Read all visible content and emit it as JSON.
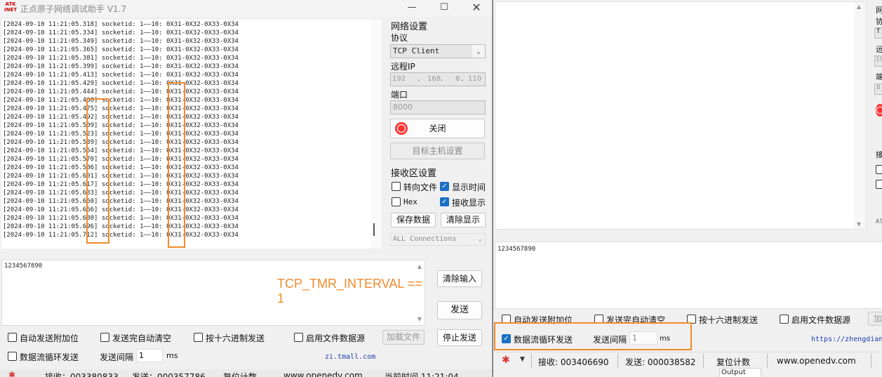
{
  "left": {
    "title": "正点原子网络调试助手 V1.7",
    "logo": "ATK INET",
    "log_lines": [
      "[2024-09-10 11:21:05.318] socketid: 1——10: 0X31-0X32-0X33-0X34",
      "[2024-09-10 11:21:05.334] socketid: 1——10: 0X31-0X32-0X33-0X34",
      "[2024-09-10 11:21:05.349] socketid: 1——10: 0X31-0X32-0X33-0X34",
      "[2024-09-10 11:21:05.365] socketid: 1——10: 0X31-0X32-0X33-0X34",
      "[2024-09-10 11:21:05.381] socketid: 1——10: 0X31-0X32-0X33-0X34",
      "[2024-09-10 11:21:05.399] socketid: 1——10: 0X31-0X32-0X33-0X34",
      "[2024-09-10 11:21:05.413] socketid: 1——10: 0X31-0X32-0X33-0X34",
      "[2024-09-10 11:21:05.429] socketid: 1——10: 0X31-0X32-0X33-0X34",
      "[2024-09-10 11:21:05.444] socketid: 1——10: 0X31-0X32-0X33-0X34",
      "[2024-09-10 11:21:05.460] socketid: 1——10: 0X31-0X32-0X33-0X34",
      "[2024-09-10 11:21:05.475] socketid: 1——10: 0X31-0X32-0X33-0X34",
      "[2024-09-10 11:21:05.492] socketid: 1——10: 0X31-0X32-0X33-0X34",
      "[2024-09-10 11:21:05.509] socketid: 1——10: 0X31-0X32-0X33-0X34",
      "[2024-09-10 11:21:05.523] socketid: 1——10: 0X31-0X32-0X33-0X34",
      "[2024-09-10 11:21:05.539] socketid: 1——10: 0X31-0X32-0X33-0X34",
      "[2024-09-10 11:21:05.554] socketid: 1——10: 0X31-0X32-0X33-0X34",
      "[2024-09-10 11:21:05.570] socketid: 1——10: 0X31-0X32-0X33-0X34",
      "[2024-09-10 11:21:05.586] socketid: 1——10: 0X31-0X32-0X33-0X34",
      "[2024-09-10 11:21:05.601] socketid: 1——10: 0X31-0X32-0X33-0X34",
      "[2024-09-10 11:21:05.617] socketid: 1——10: 0X31-0X32-0X33-0X34",
      "[2024-09-10 11:21:05.633] socketid: 1——10: 0X31-0X32-0X33-0X34",
      "[2024-09-10 11:21:05.650] socketid: 1——10: 0X31-0X32-0X33-0X34",
      "[2024-09-10 11:21:05.666] socketid: 1——10: 0X31-0X32-0X33-0X34",
      "[2024-09-10 11:21:05.680] socketid: 1——10: 0X31-0X32-0X33-0X34",
      "[2024-09-10 11:21:05.696] socketid: 1——10: 0X31-0X32-0X33-0X34",
      "[2024-09-10 11:21:05.712] socketid: 1——10: 0X31-0X32-0X33-0X34"
    ],
    "net": {
      "section": "网络设置",
      "protocol_label": "协议",
      "protocol_value": "TCP Client",
      "ip_label": "远程IP",
      "ip_parts": [
        "192",
        "168",
        "8",
        "110"
      ],
      "port_label": "端口",
      "port_value": "8000",
      "close_label": "关闭",
      "target_label": "目标主机设置"
    },
    "recv": {
      "section": "接收区设置",
      "to_file": "转向文件",
      "show_time": "显示时间",
      "hex": "Hex",
      "show_recv": "接收显示",
      "save": "保存数据",
      "clear": "清除显示",
      "connections": "ALL Connections"
    },
    "send_text": "1234567890",
    "annotation": "TCP_TMR_INTERVAL == 1",
    "clear_input": "清除输入",
    "send": "发送",
    "stop_send": "停止发送",
    "opts": {
      "auto_add": "自动发送附加位",
      "auto_clear": "发送完自动清空",
      "hex_send": "按十六进制发送",
      "file_source": "启用文件数据源",
      "load_file": "加载文件",
      "loop": "数据流循环发送",
      "interval_label": "发送间隔",
      "interval_value": "1",
      "ms": "ms",
      "link": "zi.tmall.com"
    },
    "status": {
      "recv": "接收：003380833",
      "send": "发送：000357786",
      "reset": "复位计数",
      "site": "www.openedv.com",
      "time": "当前时间 11:21:04"
    }
  },
  "right": {
    "send_text": "1234567890",
    "opts": {
      "auto_add": "自动发送附加位",
      "auto_clear": "发送完自动清空",
      "hex_send": "按十六进制发送",
      "file_source": "启用文件数据源",
      "load_file": "加载",
      "loop": "数据流循环发送",
      "interval_label": "发送间隔",
      "interval_value": "1",
      "ms": "ms",
      "link": "https://zhengdian"
    },
    "status": {
      "recv": "接收: 003406690",
      "send": "发送: 000038582",
      "reset": "复位计数",
      "site": "www.openedv.com",
      "output": "Output"
    },
    "side_labels": [
      "网",
      "协",
      "T",
      "远",
      "19",
      "端",
      "8",
      "接",
      "Al"
    ]
  },
  "colors": {
    "highlight": "#f08a2c",
    "checkbox_on": "#1a6fc4",
    "link": "#1a3fa8"
  }
}
